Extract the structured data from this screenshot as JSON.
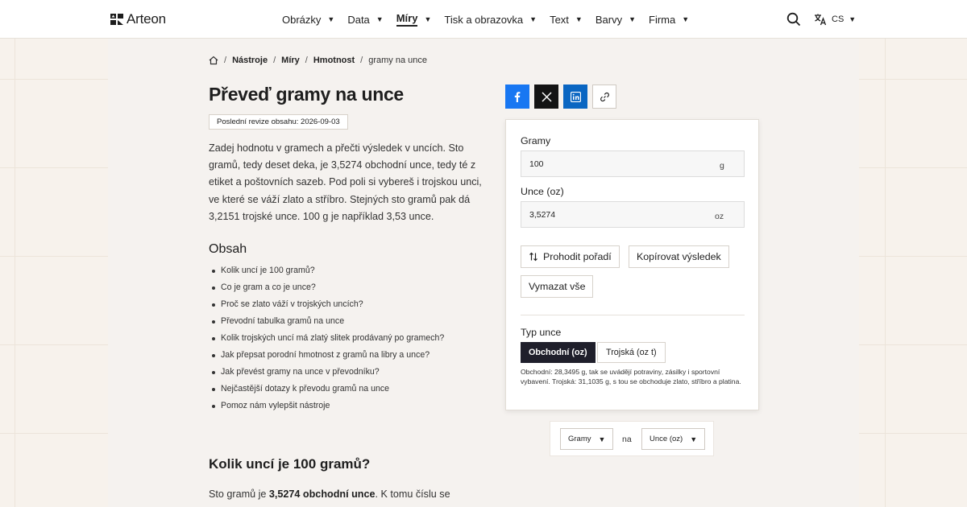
{
  "header": {
    "logo_text": "Arteon",
    "nav": [
      {
        "label": "Obrázky"
      },
      {
        "label": "Data"
      },
      {
        "label": "Míry",
        "active": true
      },
      {
        "label": "Tisk a obrazovka"
      },
      {
        "label": "Text"
      },
      {
        "label": "Barvy"
      },
      {
        "label": "Firma"
      }
    ],
    "language": "CS"
  },
  "breadcrumb": {
    "items": [
      "Nástroje",
      "Míry",
      "Hmotnost"
    ],
    "current": "gramy na unce"
  },
  "page": {
    "title": "Převeď gramy na unce",
    "revision": "Poslední revize obsahu: 2026-09-03",
    "intro": "Zadej hodnotu v gramech a přečti výsledek v uncích. Sto gramů, tedy deset deka, je 3,5274 obchodní unce, tedy té z etiket a poštovních sazeb. Pod poli si vybereš i trojskou unci, ve které se váží zlato a stříbro. Stejných sto gramů pak dá 3,2151 trojské unce. 100 g je například 3,53 unce."
  },
  "toc": {
    "title": "Obsah",
    "items": [
      "Kolik uncí je 100 gramů?",
      "Co je gram a co je unce?",
      "Proč se zlato váží v trojských uncích?",
      "Převodní tabulka gramů na unce",
      "Kolik trojských uncí má zlatý slitek prodávaný po gramech?",
      "Jak přepsat porodní hmotnost z gramů na libry a unce?",
      "Jak převést gramy na unce v převodníku?",
      "Nejčastější dotazy k převodu gramů na unce",
      "Pomoz nám vylepšit nástroje"
    ]
  },
  "section": {
    "title": "Kolik uncí je 100 gramů?",
    "text_before": "Sto gramů je ",
    "text_bold": "3,5274 obchodní unce",
    "text_after": ". K tomu číslu se"
  },
  "share": {
    "facebook": "facebook-icon",
    "x": "x-icon",
    "linkedin": "linkedin-icon",
    "copy_link": "link-icon",
    "colors": {
      "facebook": "#1877f2",
      "x": "#141414",
      "linkedin": "#0a66c2"
    }
  },
  "converter": {
    "grams_label": "Gramy",
    "grams_value": "100",
    "grams_unit": "g",
    "ounces_label": "Unce (oz)",
    "ounces_value": "3,5274",
    "ounces_unit": "oz",
    "swap_label": "Prohodit pořadí",
    "copy_label": "Kopírovat výsledek",
    "clear_label": "Vymazat vše",
    "ounce_type_label": "Typ unce",
    "options": [
      "Obchodní (oz)",
      "Trojská (oz t)"
    ],
    "selected_option": "Obchodní (oz)",
    "note": "Obchodní: 28,3495 g, tak se uvádějí potraviny, zásilky i sportovní vybavení. Trojská: 31,1035 g, s tou se obchoduje zlato, stříbro a platina.",
    "accent_color": "#1f1f2b"
  },
  "unit_switch": {
    "from": "Gramy",
    "joiner": "na",
    "to": "Unce (oz)"
  }
}
